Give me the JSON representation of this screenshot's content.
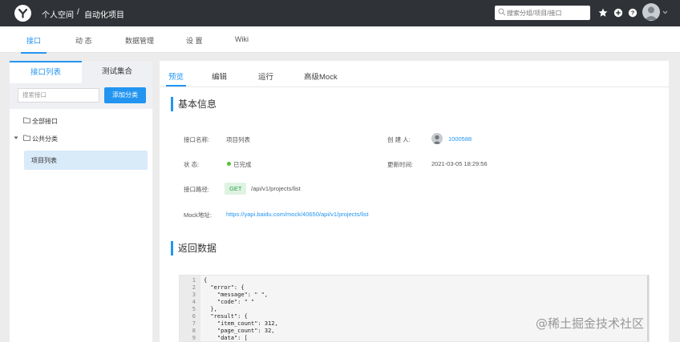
{
  "header": {
    "breadcrumb_space": "个人空间",
    "breadcrumb_sep": "/",
    "breadcrumb_project": "自动化项目",
    "search_placeholder": "搜索分组/项目/接口"
  },
  "subnav": {
    "tabs": [
      {
        "label": "接口"
      },
      {
        "label": "动 态"
      },
      {
        "label": "数据管理"
      },
      {
        "label": "设 置"
      },
      {
        "label": "Wiki"
      }
    ],
    "active": "接口"
  },
  "left_panel": {
    "tab_interface_list": "接口列表",
    "tab_test_collection": "测试集合",
    "search_placeholder": "搜索接口",
    "add_category_button": "添加分类",
    "tree": {
      "all": "全部接口",
      "category": "公共分类",
      "item": "项目列表"
    }
  },
  "right_panel": {
    "tabs": [
      {
        "label": "预览"
      },
      {
        "label": "编辑"
      },
      {
        "label": "运行"
      },
      {
        "label": "高级Mock"
      }
    ],
    "basic_info_title": "基本信息",
    "fields": {
      "name_label": "接口名称:",
      "name_value": "项目列表",
      "creator_label": "创 建 人:",
      "creator_value": "1000588",
      "status_label": "状    态:",
      "status_value": "已完成",
      "updated_label": "更新时间:",
      "updated_value": "2021-03-05 18:29:56",
      "path_label": "接口路径:",
      "path_method": "GET",
      "path_value": "/api/v1/projects/list",
      "mock_label": "Mock地址:",
      "mock_value": "https://yapi.baidu.com/mock/40650/api/v1/projects/list"
    },
    "response_title": "返回数据",
    "code_lines": [
      {
        "n": "1",
        "t": "{"
      },
      {
        "n": "2",
        "t": "  \"error\": {"
      },
      {
        "n": "3",
        "t": "    \"message\": \" \","
      },
      {
        "n": "4",
        "t": "    \"code\": \" \""
      },
      {
        "n": "5",
        "t": "  },"
      },
      {
        "n": "6",
        "t": "  \"result\": {"
      },
      {
        "n": "7",
        "t": "    \"item_count\": 312,"
      },
      {
        "n": "8",
        "t": "    \"page_count\": 32,"
      },
      {
        "n": "9",
        "t": "    \"data\": ["
      }
    ]
  },
  "watermark": "@稀土掘金技术社区",
  "colors": {
    "accent": "#2395f1",
    "topbar": "#2f3236",
    "status_done": "#57c22d",
    "method_get_bg": "#dff3e2",
    "method_get_fg": "#2aa24a"
  },
  "icons": [
    "yapi-logo-icon",
    "search-icon",
    "star-icon",
    "plus-circle-icon",
    "help-circle-icon",
    "user-avatar-icon",
    "chevron-down-icon",
    "folder-icon",
    "caret-down-icon"
  ]
}
